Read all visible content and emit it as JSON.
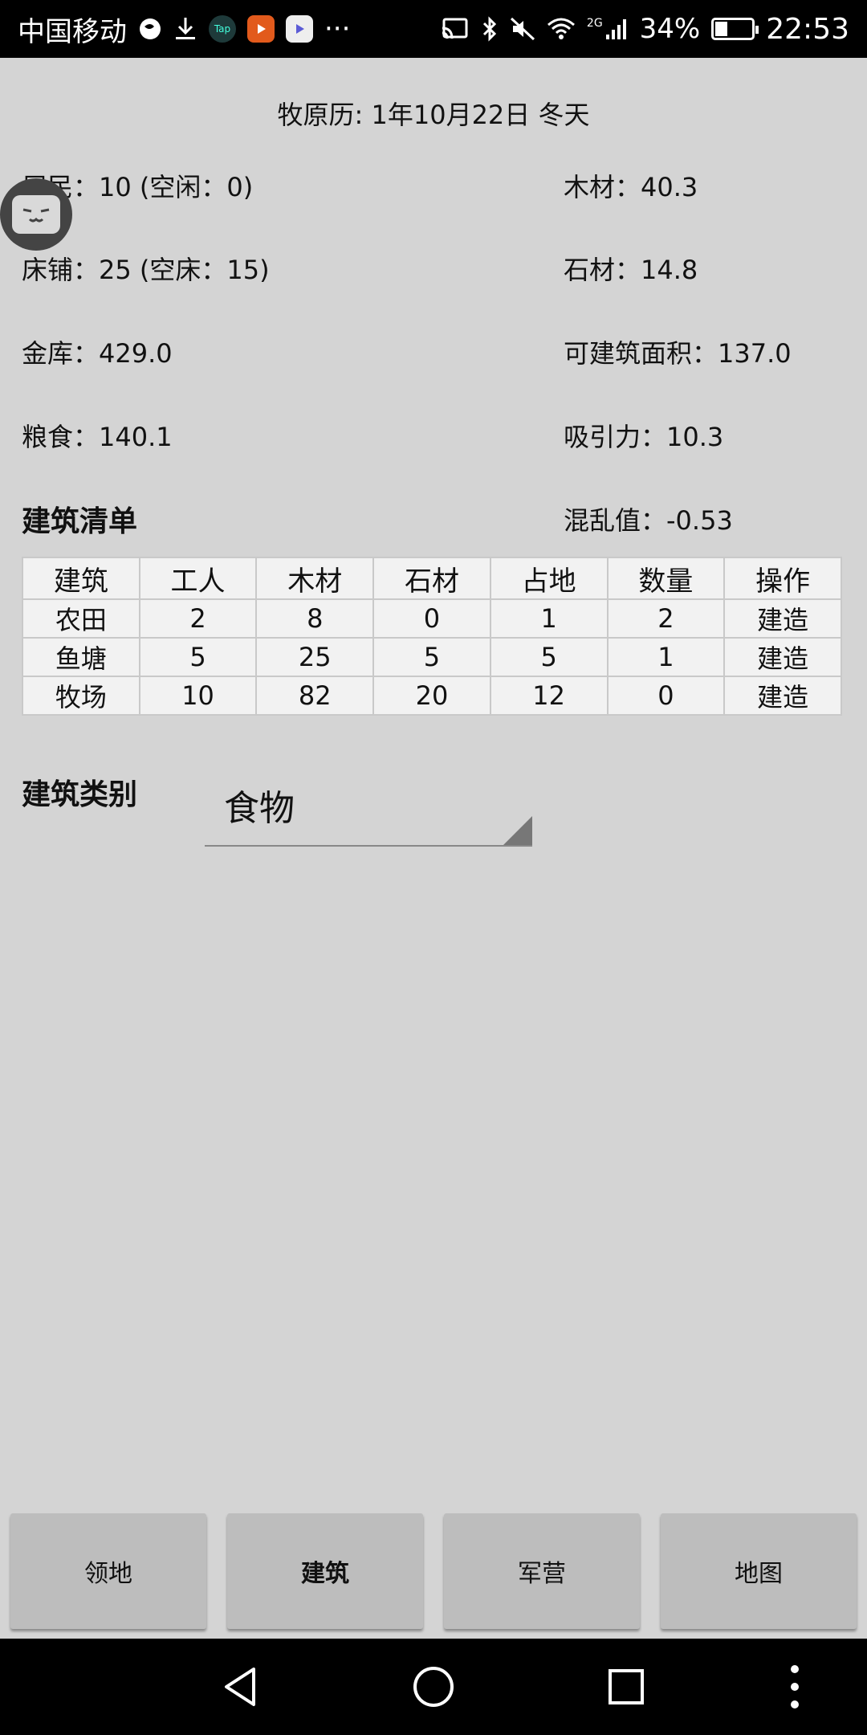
{
  "status_bar": {
    "carrier": "中国移动",
    "extras": "···",
    "network": "2G",
    "battery_percent": "34%",
    "battery_level": 0.34,
    "time": "22:53"
  },
  "header": {
    "calendar": "牧原历: 1年10月22日  冬天"
  },
  "stats": {
    "residents": "居民：10 (空闲：0)",
    "wood": "木材：40.3",
    "beds": "床铺：25 (空床：15)",
    "stone": "石材：14.8",
    "treasury": "金库：429.0",
    "buildable_area": "可建筑面积：137.0",
    "food": "粮食：140.1",
    "attraction": "吸引力：10.3",
    "chaos": "混乱值：-0.53"
  },
  "building_list": {
    "title": "建筑清单",
    "columns": [
      "建筑",
      "工人",
      "木材",
      "石材",
      "占地",
      "数量",
      "操作"
    ],
    "rows": [
      [
        "农田",
        "2",
        "8",
        "0",
        "1",
        "2",
        "建造"
      ],
      [
        "鱼塘",
        "5",
        "25",
        "5",
        "5",
        "1",
        "建造"
      ],
      [
        "牧场",
        "10",
        "82",
        "20",
        "12",
        "0",
        "建造"
      ]
    ]
  },
  "category": {
    "label": "建筑类别",
    "selected": "食物"
  },
  "tabs": [
    {
      "label": "领地",
      "active": false
    },
    {
      "label": "建筑",
      "active": true
    },
    {
      "label": "军营",
      "active": false
    },
    {
      "label": "地图",
      "active": false
    }
  ],
  "icons": {
    "nav_back": "back-triangle-icon",
    "nav_home": "home-circle-icon",
    "nav_recents": "recents-square-icon",
    "nav_menu": "more-vertical-icon"
  }
}
